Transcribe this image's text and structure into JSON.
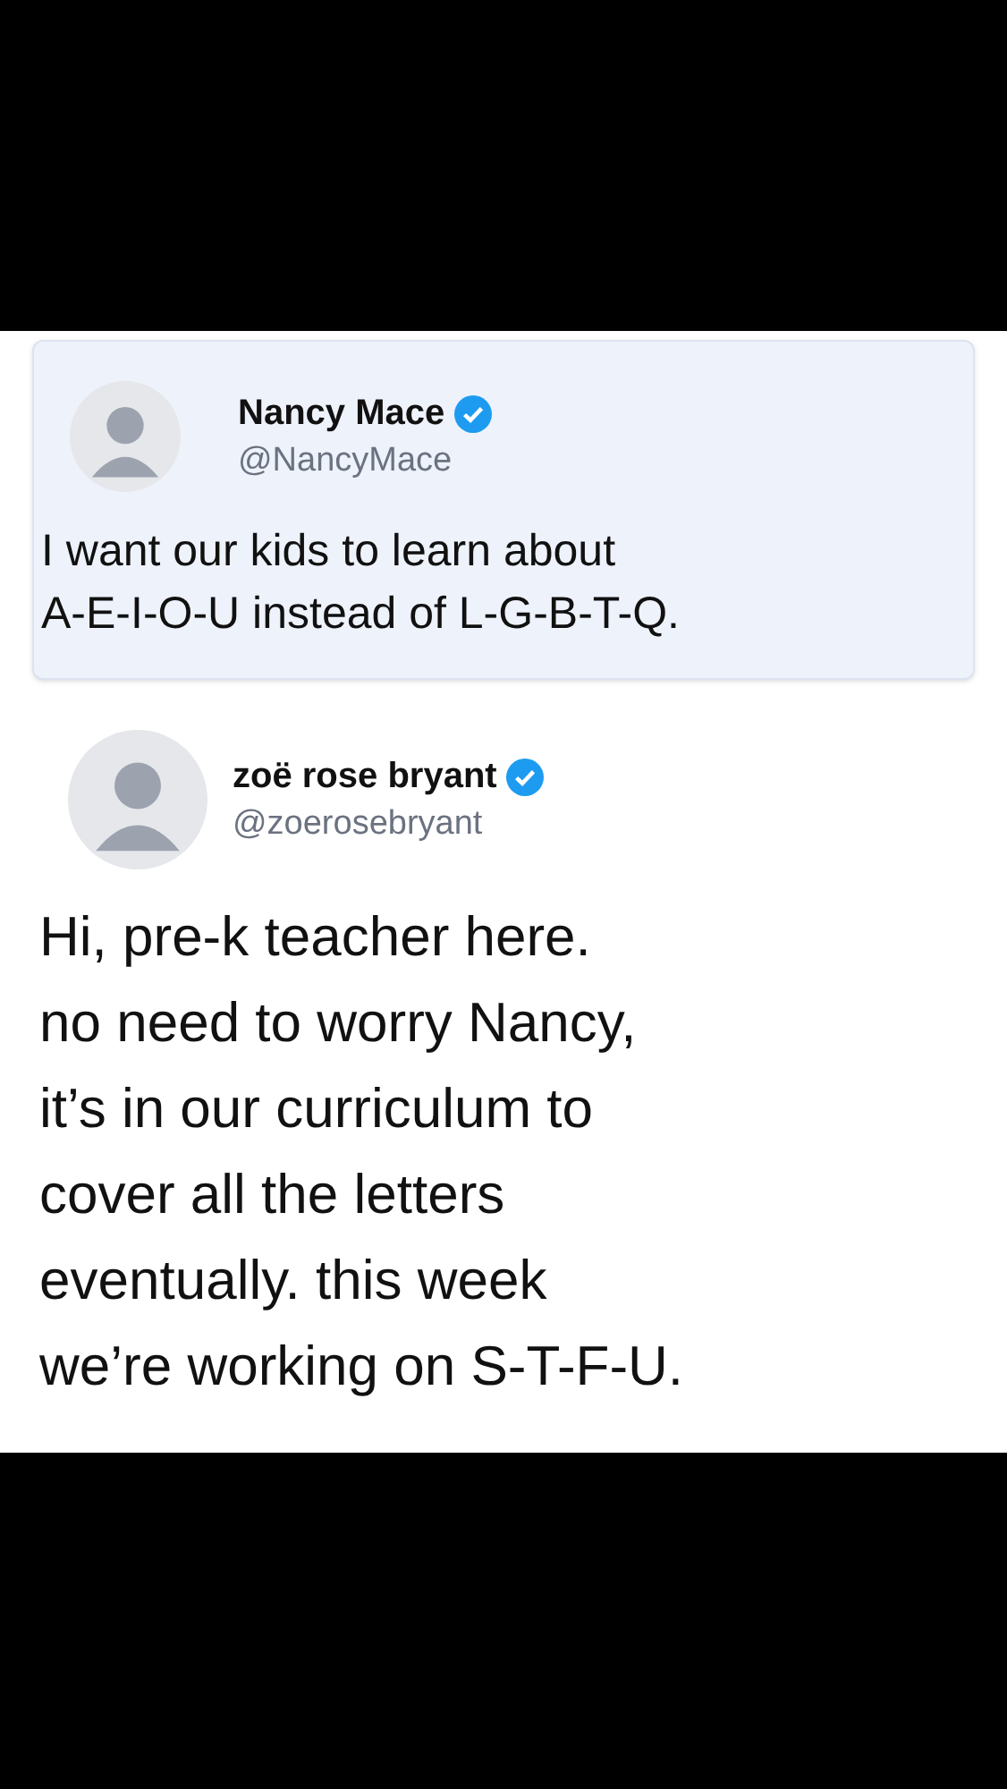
{
  "tweets": [
    {
      "name": "Nancy Mace",
      "handle": "@NancyMace",
      "verified": true,
      "highlighted": true,
      "text": "I want our kids to learn about\nA-E-I-O-U instead of L-G-B-T-Q."
    },
    {
      "name": "zoë rose bryant",
      "handle": "@zoerosebryant",
      "verified": true,
      "highlighted": false,
      "text": "Hi, pre-k teacher here.\nno need to worry Nancy,\nit’s in our curriculum to\ncover all the letters\neventually. this week\nwe’re working on S-T-F-U."
    }
  ]
}
